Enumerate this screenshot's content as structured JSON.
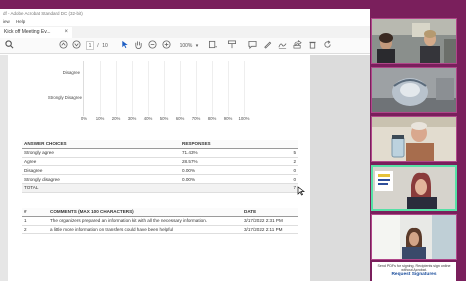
{
  "window": {
    "title": "df - Adobe Acrobat Standard DC (32-bit)",
    "menu": [
      "iew",
      "Help"
    ],
    "tab_title": "Kick off Meeting Ev...",
    "tab_close": "×"
  },
  "toolbar": {
    "page_current": "1",
    "page_sep": "/",
    "page_total": "10",
    "zoom": "100%",
    "zoom_caret": "▾"
  },
  "chart_data": {
    "type": "bar",
    "orientation": "horizontal",
    "categories": [
      "Disagree",
      "Strongly Disagree"
    ],
    "values": [
      0,
      0
    ],
    "xlim": [
      0,
      100
    ],
    "x_ticks": [
      "0%",
      "10%",
      "20%",
      "30%",
      "40%",
      "50%",
      "60%",
      "70%",
      "80%",
      "90%",
      "100%"
    ],
    "grid": true
  },
  "responses_table": {
    "headers": [
      "ANSWER CHOICES",
      "RESPONSES",
      ""
    ],
    "rows": [
      {
        "choice": "Strongly agree",
        "pct": "71.43%",
        "count": "5"
      },
      {
        "choice": "Agree",
        "pct": "28.57%",
        "count": "2"
      },
      {
        "choice": "Disagree",
        "pct": "0.00%",
        "count": "0"
      },
      {
        "choice": "Strongly disagree",
        "pct": "0.00%",
        "count": "0"
      }
    ],
    "total_label": "TOTAL",
    "total_count": "7"
  },
  "comments_table": {
    "headers": [
      "#",
      "COMMENTS   (MAX 100 CHARACTERS)",
      "DATE"
    ],
    "rows": [
      {
        "num": "1",
        "comment": "The organizers prepared an information kit with all the necessary information.",
        "date": "3/17/2022 2:31 PM"
      },
      {
        "num": "2",
        "comment": "a little more information on transfers could have been helpful",
        "date": "3/17/2022 2:11 PM"
      }
    ]
  },
  "promo": {
    "text": "Send PDFs for signing. Recipients sign online without Acrobat.",
    "button": "Request Signatures"
  },
  "colors": {
    "background": "#7a1f5c",
    "active_speaker": "#57e0a6"
  }
}
